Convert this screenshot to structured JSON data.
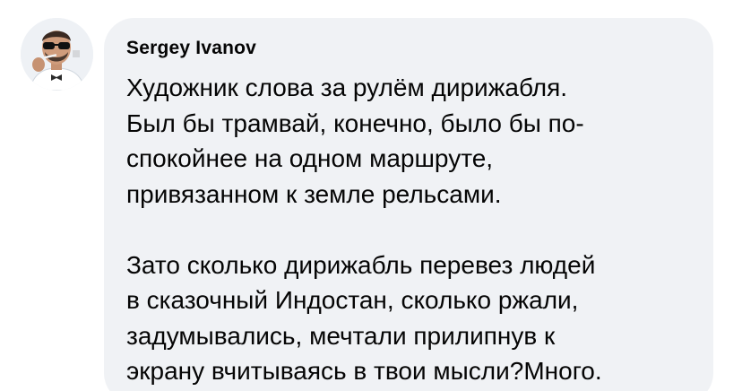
{
  "comment": {
    "author": "Sergey Ivanov",
    "avatar_icon": "user-avatar-photo",
    "paragraphs": [
      [
        "Художник слова за рулём дирижабля.",
        "Был бы трамвай, конечно, было бы по-",
        "спокойнее на одном маршруте,",
        "привязанном к земле рельсами."
      ],
      [
        "Зато сколько дирижабль перевез людей",
        "в сказочный Индостан, сколько ржали,",
        "задумывались, мечтали прилипнув к",
        "экрану вчитываясь в твои мысли?Много."
      ]
    ]
  },
  "colors": {
    "bubble_background": "#f0f2f5",
    "text": "#050505"
  }
}
